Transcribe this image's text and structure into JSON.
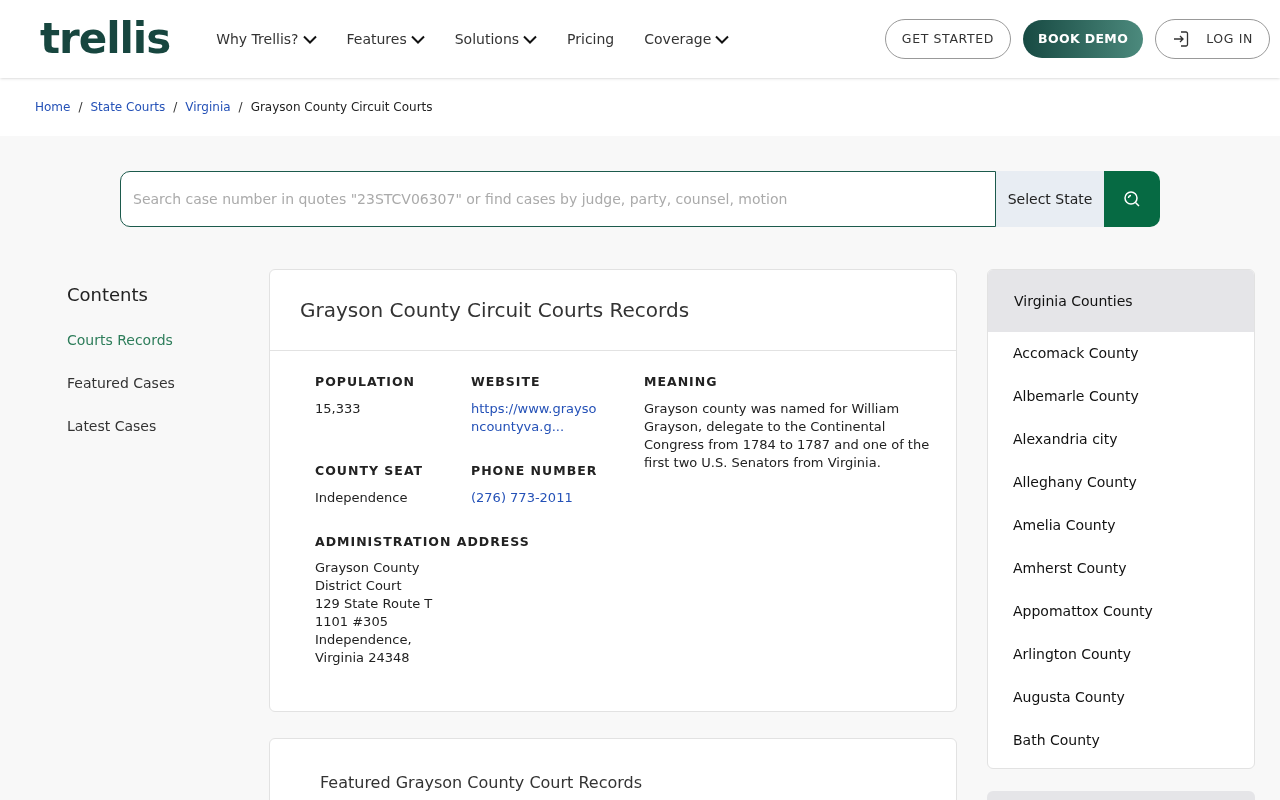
{
  "header": {
    "logo": "trellis",
    "nav": [
      {
        "label": "Why Trellis?",
        "dropdown": true
      },
      {
        "label": "Features",
        "dropdown": true
      },
      {
        "label": "Solutions",
        "dropdown": true
      },
      {
        "label": "Pricing",
        "dropdown": false
      },
      {
        "label": "Coverage",
        "dropdown": true
      }
    ],
    "buttons": [
      {
        "label": "GET STARTED",
        "kind": "outline"
      },
      {
        "label": "BOOK DEMO",
        "kind": "primary"
      },
      {
        "label": "LOG IN",
        "kind": "login"
      }
    ]
  },
  "breadcrumb": [
    {
      "label": "Home",
      "link": true
    },
    {
      "label": "State Courts",
      "link": true
    },
    {
      "label": "Virginia",
      "link": true
    },
    {
      "label": "Grayson County Circuit Courts",
      "link": false
    }
  ],
  "breadcrumb_separator": "/",
  "search": {
    "placeholder": "Search case number in quotes \"23STCV06307\" or find cases by judge, party, counsel, motion",
    "state_select": "Select State"
  },
  "contents": {
    "title": "Contents",
    "items": [
      {
        "label": "Courts Records",
        "selected": true
      },
      {
        "label": "Featured Cases",
        "selected": false
      },
      {
        "label": "Latest Cases",
        "selected": false
      }
    ]
  },
  "records_card": {
    "title": "Grayson County Circuit Courts Records",
    "fields": [
      {
        "label": "POPULATION",
        "value": "15,333",
        "kind": "text"
      },
      {
        "label": "WEBSITE",
        "value": "https://www.graysoncountyva.g...",
        "kind": "link"
      },
      {
        "label": "COUNTY SEAT",
        "value": "Independence",
        "kind": "text"
      },
      {
        "label": "PHONE NUMBER",
        "value": "(276) 773-2011",
        "kind": "link"
      },
      {
        "label": "ADMINISTRATION ADDRESS",
        "lines": [
          "Grayson County",
          "District Court",
          "129 State Route T",
          "1101 #305",
          "Independence,",
          "Virginia 24348"
        ],
        "kind": "address"
      }
    ],
    "meaning": {
      "label": "MEANING",
      "value": "Grayson county was named for William Grayson, delegate to the Continental Congress from 1784 to 1787 and one of the first two U.S. Senators from Virginia."
    }
  },
  "featured_card": {
    "title": "Featured Grayson County Court Records"
  },
  "counties": {
    "title": "Virginia Counties",
    "items": [
      "Accomack County",
      "Albemarle County",
      "Alexandria city",
      "Alleghany County",
      "Amelia County",
      "Amherst County",
      "Appomattox County",
      "Arlington County",
      "Augusta County",
      "Bath County"
    ]
  }
}
